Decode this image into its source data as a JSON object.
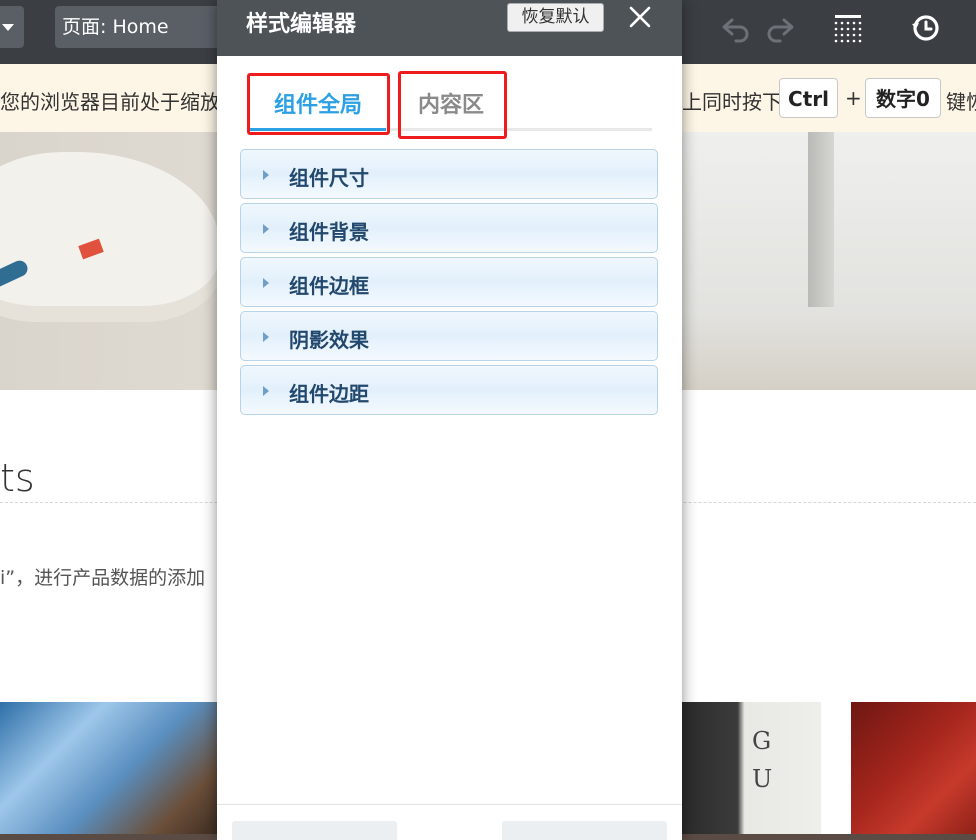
{
  "toolbar": {
    "page_label": "页面:  Home",
    "icons": [
      "chevron-down-icon",
      "undo-icon",
      "redo-icon",
      "grid-icon",
      "history-icon"
    ]
  },
  "notice": {
    "left_text": "您的浏览器目前处于缩放",
    "right_text": "上同时按下",
    "key_ctrl": "Ctrl",
    "plus": "+",
    "key_zero": "数字0",
    "tail": "键恢"
  },
  "page": {
    "section_title": "ts",
    "section_text": "i”，进行产品数据的添加"
  },
  "photo_letters": "G\nU",
  "editor": {
    "title": "样式编辑器",
    "reset_label": "恢复默认",
    "tabs": [
      {
        "label": "组件全局",
        "active": true
      },
      {
        "label": "内容区",
        "active": false
      }
    ],
    "sections": [
      {
        "label": "组件尺寸"
      },
      {
        "label": "组件背景"
      },
      {
        "label": "组件边框"
      },
      {
        "label": "阴影效果"
      },
      {
        "label": "组件边距"
      }
    ]
  },
  "colors": {
    "accent": "#2ba0e2",
    "highlight": "#ee1c1c",
    "header": "#4e5358",
    "toolbar": "#3b3f44"
  }
}
